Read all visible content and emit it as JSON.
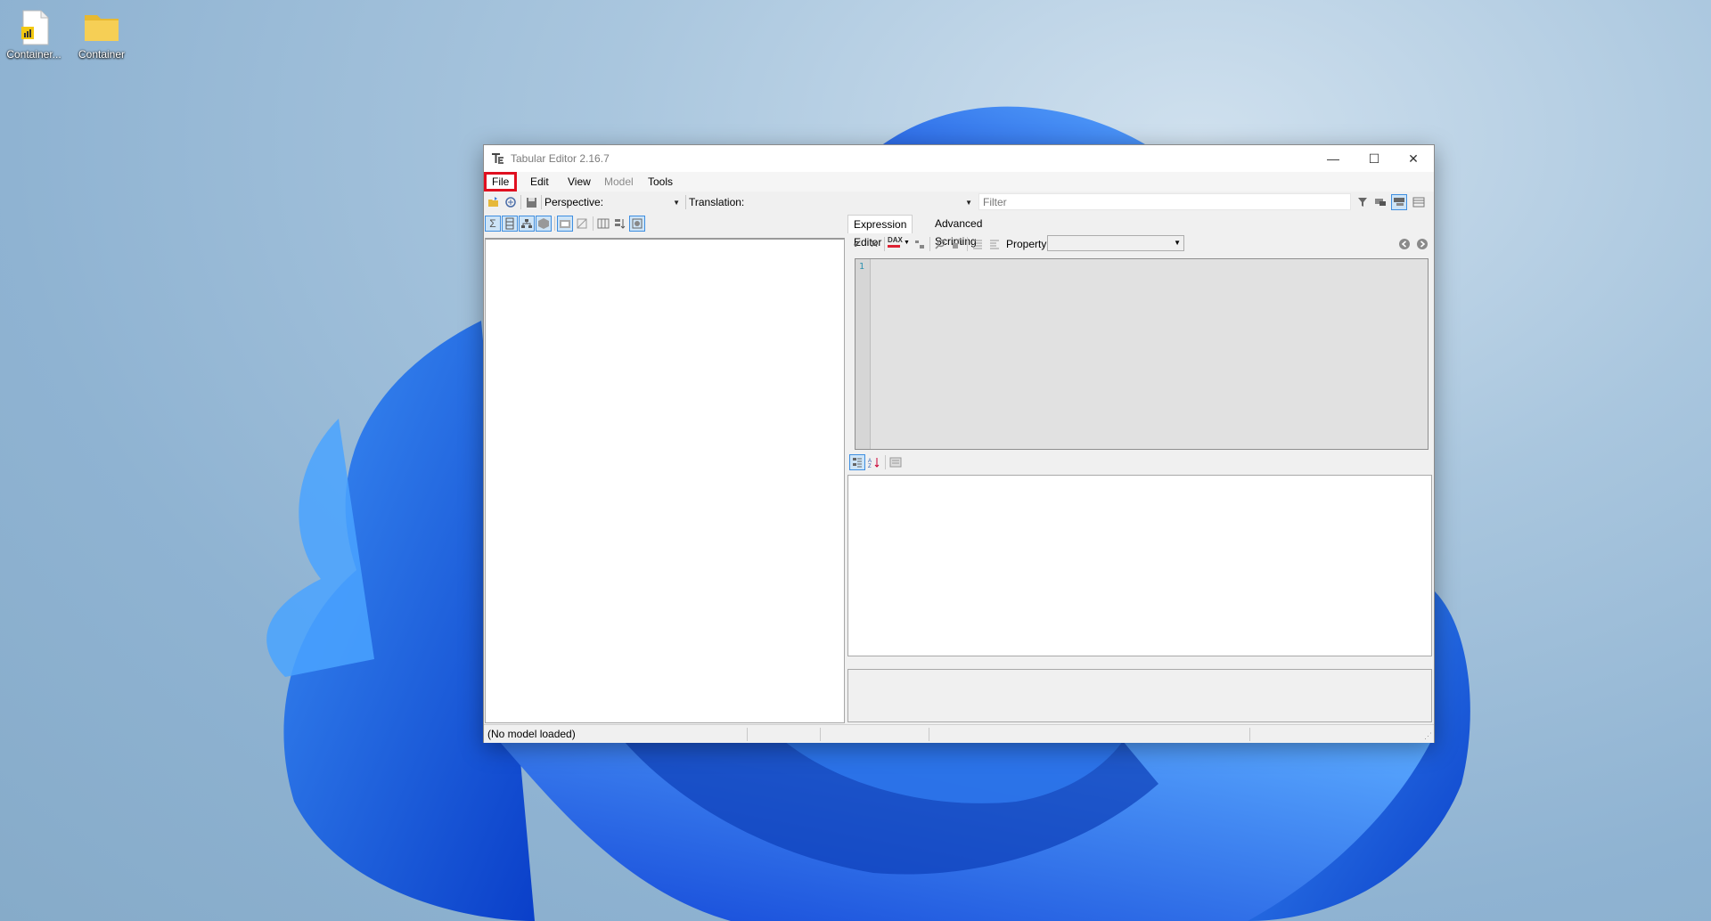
{
  "desktop": {
    "icons": [
      {
        "label": "Container...",
        "icon": "pbix-file-icon"
      },
      {
        "label": "Container",
        "icon": "folder-icon"
      }
    ]
  },
  "window": {
    "title": "Tabular Editor 2.16.7",
    "controls": {
      "minimize": "—",
      "maximize": "☐",
      "close": "✕"
    },
    "menu": {
      "file": "File",
      "edit": "Edit",
      "view": "View",
      "model": "Model",
      "tools": "Tools"
    },
    "toolbar": {
      "perspective_label": "Perspective:",
      "translation_label": "Translation:",
      "filter_placeholder": "Filter",
      "dropdown_arrow": "▼"
    },
    "tabs": {
      "expression_editor": "Expression Editor",
      "advanced_scripting": "Advanced Scripting"
    },
    "expression": {
      "property_label": "Property:",
      "line_number": "1",
      "dax_label": "DAX"
    },
    "status": {
      "model_state": "(No model loaded)"
    },
    "highlight_color": "#e01020",
    "selected_button_color": "#3e8ee0"
  }
}
